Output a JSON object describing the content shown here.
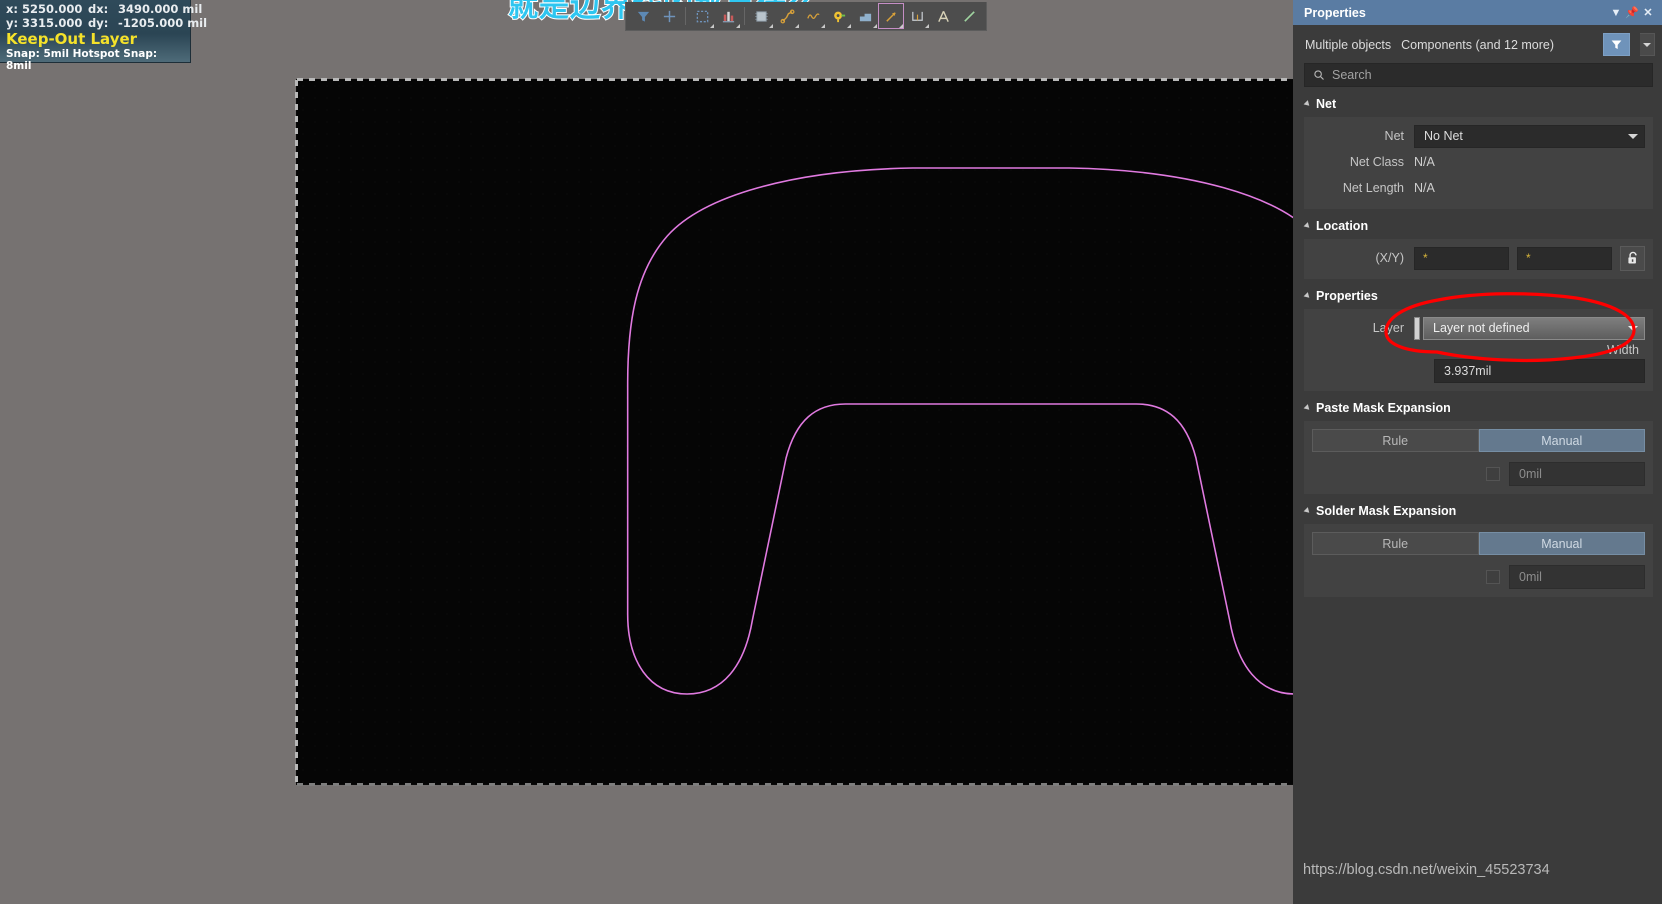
{
  "hud": {
    "x_label": "x:",
    "x_value": "5250.000",
    "dx_label": "dx:",
    "dx_value": "3490.000 mil",
    "y_label": "y:",
    "y_value": "3315.000",
    "dy_label": "dy:",
    "dy_value": "-1205.000 mil",
    "layer": "Keep-Out Layer",
    "snap": "Snap: 5mil Hotspot Snap: 8mil"
  },
  "banner": {
    "text": "就是边界线的那是什么"
  },
  "toolbar": {
    "items": [
      {
        "name": "filter-tool",
        "icon": "filter-icon",
        "caret": false,
        "framed": false
      },
      {
        "name": "crosshair-tool",
        "icon": "crosshair-icon",
        "caret": false,
        "framed": false
      },
      {
        "name": "place-rectangle",
        "icon": "dashed-square-icon",
        "caret": true,
        "framed": false
      },
      {
        "name": "place-component",
        "icon": "bar-chart-icon",
        "caret": true,
        "framed": false
      },
      {
        "name": "place-pad",
        "icon": "chip-icon",
        "caret": true,
        "framed": false
      },
      {
        "name": "place-route",
        "icon": "route-icon",
        "caret": true,
        "framed": false
      },
      {
        "name": "place-differential",
        "icon": "wave-icon",
        "caret": true,
        "framed": false
      },
      {
        "name": "place-via",
        "icon": "via-key-icon",
        "caret": true,
        "framed": false
      },
      {
        "name": "place-polygon",
        "icon": "polygon-icon",
        "caret": true,
        "framed": false
      },
      {
        "name": "place-line",
        "icon": "arrow-line-icon",
        "caret": true,
        "framed": true
      },
      {
        "name": "place-dimension",
        "icon": "dimension-icon",
        "caret": true,
        "framed": false
      },
      {
        "name": "place-string",
        "icon": "text-a-icon",
        "caret": false,
        "framed": false
      },
      {
        "name": "place-track",
        "icon": "pencil-line-icon",
        "caret": false,
        "framed": false
      }
    ]
  },
  "panel": {
    "title": "Properties",
    "title_buttons": [
      "dropdown-arrow",
      "pin",
      "close"
    ],
    "objects_line_1": "Multiple objects",
    "objects_line_2": "Components (and 12 more)",
    "search_placeholder": "Search",
    "sections": {
      "net": {
        "header": "Net",
        "net_label": "Net",
        "net_value": "No Net",
        "net_class_label": "Net Class",
        "net_class_value": "N/A",
        "net_length_label": "Net Length",
        "net_length_value": "N/A"
      },
      "location": {
        "header": "Location",
        "xy_label": "(X/Y)",
        "x_value": "*",
        "y_value": "*",
        "lock_icon": "unlocked-padlock-icon"
      },
      "properties": {
        "header": "Properties",
        "layer_label": "Layer",
        "layer_value": "Layer not defined",
        "width_label": "Width",
        "width_value": "3.937mil"
      },
      "paste_mask": {
        "header": "Paste Mask Expansion",
        "option_rule": "Rule",
        "option_manual": "Manual",
        "selected": "Manual",
        "value": "0mil",
        "checkbox_checked": false
      },
      "solder_mask": {
        "header": "Solder Mask Expansion",
        "option_rule": "Rule",
        "option_manual": "Manual",
        "selected": "Manual",
        "value": "0mil",
        "checkbox_checked": false
      }
    }
  },
  "watermark": {
    "text": "https://blog.csdn.net/weixin_45523734"
  },
  "colors": {
    "panel_title_bg": "#5a7ca3",
    "panel_bg": "#3b3b3b",
    "canvas_bg": "#050505",
    "workspace_bg": "#767271",
    "keepout_outline": "#e07ae0",
    "annotation": "#fe0000",
    "hud_layer_text": "#f5e22a",
    "banner_text": "#2ec6f0"
  }
}
